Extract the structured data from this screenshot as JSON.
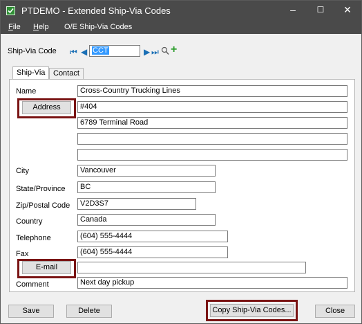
{
  "window": {
    "title": "PTDEMO - Extended Ship-Via Codes",
    "minimize": "–",
    "maximize": "☐",
    "close": "✕"
  },
  "menu": {
    "file": "File",
    "help": "Help",
    "oe": "O/E Ship-Via Codes"
  },
  "lookup": {
    "label": "Ship-Via Code",
    "value": "CCT",
    "first": "⏮",
    "prev": "◀",
    "next": "▶",
    "last": "⏭",
    "find": "🔍",
    "add": "+"
  },
  "tabs": {
    "ship_via": "Ship-Via",
    "contact": "Contact"
  },
  "fields": {
    "name_label": "Name",
    "name": "Cross-Country Trucking Lines",
    "address_button": "Address",
    "address1": "#404",
    "address2": "6789 Terminal Road",
    "address3": "",
    "address4": "",
    "city_label": "City",
    "city": "Vancouver",
    "state_label": "State/Province",
    "state": "BC",
    "zip_label": "Zip/Postal Code",
    "zip": "V2D3S7",
    "country_label": "Country",
    "country": "Canada",
    "phone_label": "Telephone",
    "phone": "(604) 555-4444",
    "fax_label": "Fax",
    "fax": "(604) 555-4444",
    "email_button": "E-mail",
    "email": "",
    "comment_label": "Comment",
    "comment": "Next day pickup"
  },
  "buttons": {
    "save": "Save",
    "delete": "Delete",
    "copy": "Copy Ship-Via Codes...",
    "close": "Close"
  },
  "colors": {
    "titlebar": "#4a4a4a",
    "highlight": "#7a1414",
    "nav_blue": "#1a6fb5",
    "add_green": "#2e9e2e"
  }
}
